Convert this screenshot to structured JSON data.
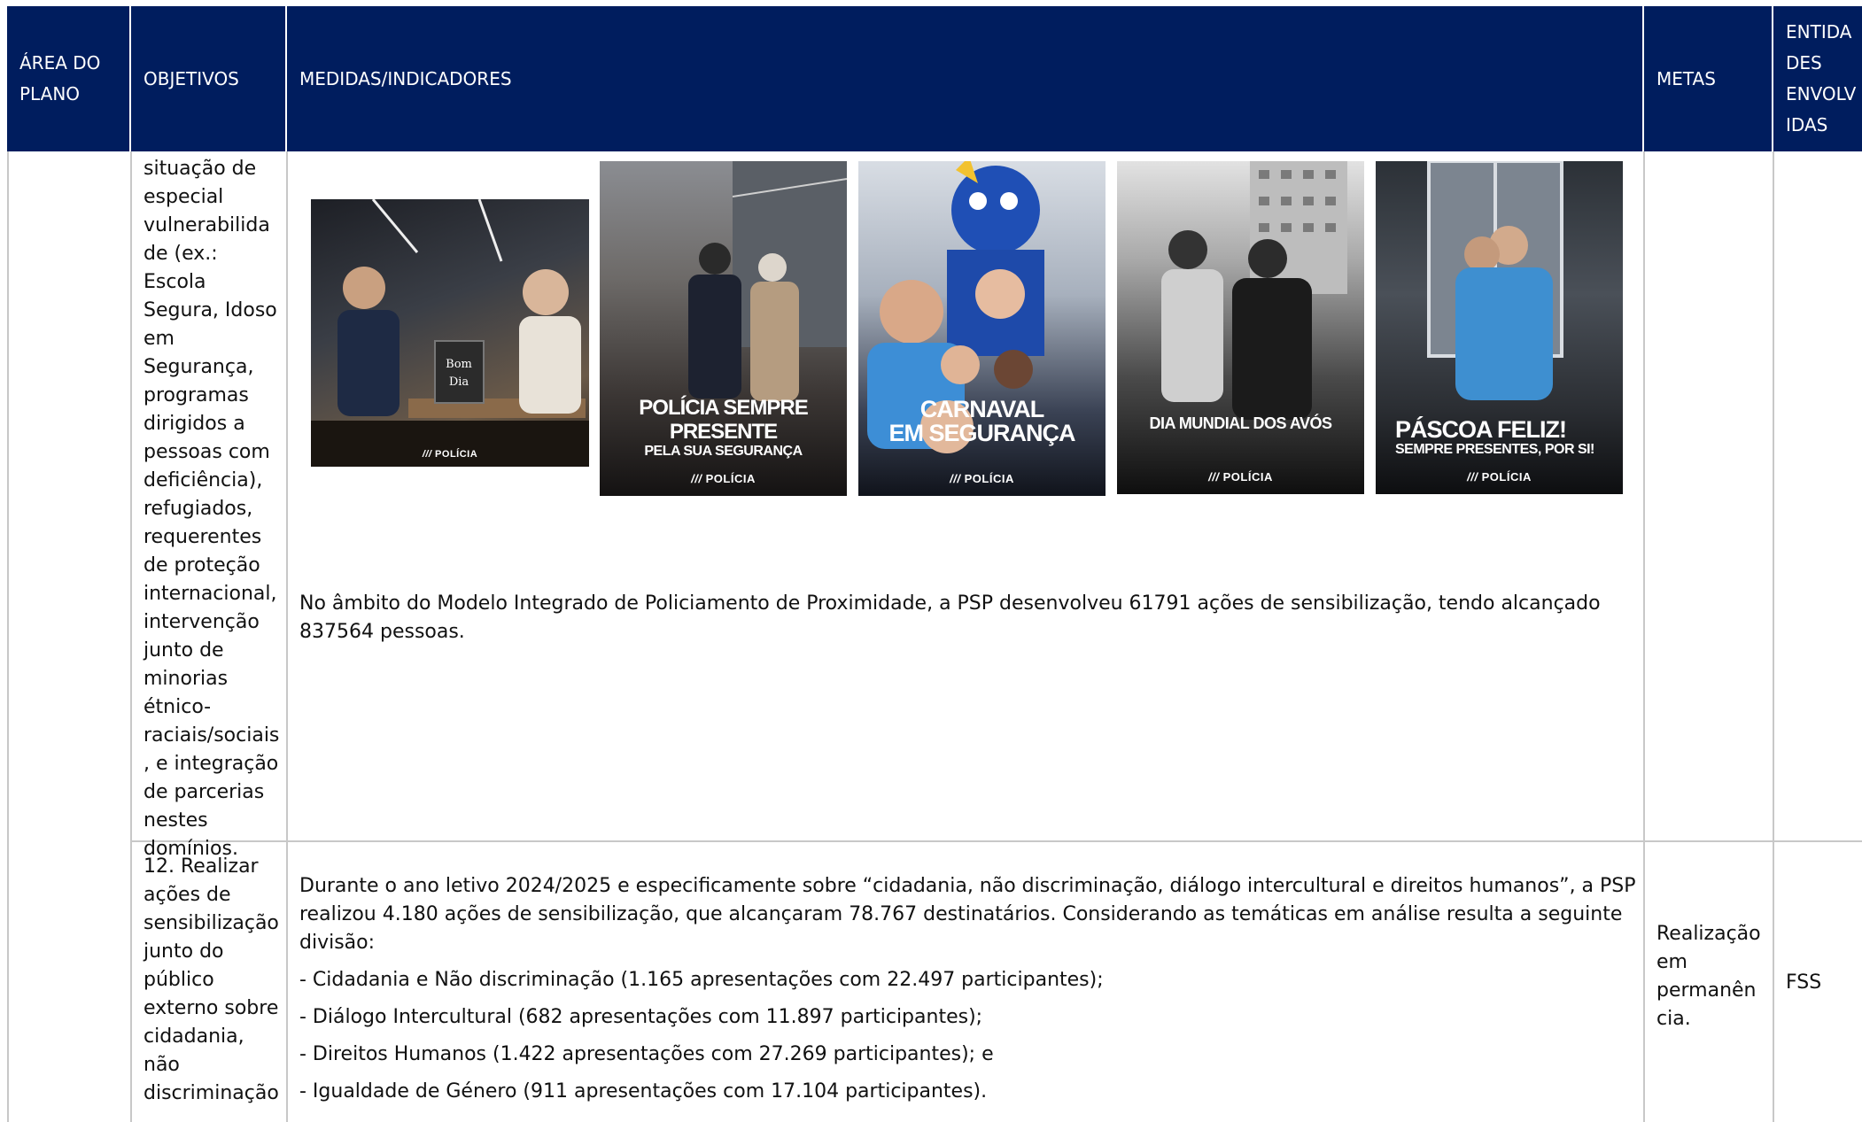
{
  "header": {
    "area": [
      "ÁREA DO",
      "PLANO"
    ],
    "objetivos": "OBJETIVOS",
    "medidas": "MEDIDAS/INDICADORES",
    "metas": "METAS",
    "entidades": [
      "ENTIDA",
      "DES",
      "ENVOLV",
      "IDAS"
    ]
  },
  "row1": {
    "objective_text": "situação de\nespecial\nvulnerabilida\nde (ex.: Escola\nSegura, Idoso\nem\nSegurança,\nprogramas\ndirigidos a\npessoas com\ndeficiência),\nrefugiados,\nrequerentes\nde proteção\ninternacional,\nintervenção\njunto de\nminorias\nétnico-\nraciais/sociais\n, e integração\nde parcerias\nnestes\ndomínios.",
    "photos": [
      {
        "caption1": "",
        "caption2": "",
        "brand": "POLÍCIA",
        "sign": "Bom Dia"
      },
      {
        "caption1": "POLÍCIA SEMPRE PRESENTE",
        "caption2": "PELA SUA SEGURANÇA",
        "brand": "POLÍCIA"
      },
      {
        "caption1": "CARNAVAL",
        "caption1b": "EM SEGURANÇA",
        "brand": "POLÍCIA"
      },
      {
        "caption1": "DIA MUNDIAL DOS AVÓS",
        "brand": "POLÍCIA"
      },
      {
        "caption1": "PÁSCOA FELIZ!",
        "caption2": "SEMPRE PRESENTES, POR SI!",
        "brand": "POLÍCIA"
      }
    ],
    "summary": "No âmbito do Modelo Integrado de Policiamento de Proximidade, a PSP desenvolveu 61791 ações de sensibilização, tendo alcançado 837564 pessoas."
  },
  "row2": {
    "objective_text": "12. Realizar\nações de\nsensibilização\njunto do\npúblico\nexterno sobre\ncidadania,\nnão\ndiscriminação",
    "intro": "Durante o ano letivo 2024/2025 e especificamente sobre “cidadania, não discriminação, diálogo intercultural e direitos humanos”, a PSP realizou 4.180 ações de sensibilização, que alcançaram 78.767 destinatários. Considerando as temáticas em análise resulta a seguinte divisão:",
    "bullets": [
      "- Cidadania e Não discriminação (1.165 apresentações com 22.497 participantes);",
      "- Diálogo Intercultural (682 apresentações com 11.897 participantes);",
      "- Direitos Humanos (1.422 apresentações com 27.269 participantes); e",
      "- Igualdade de Género (911 apresentações com 17.104 participantes)."
    ],
    "metas": "Realização\nem\npermanên\ncia.",
    "entidades": "FSS"
  },
  "colors": {
    "header_bg": "#001d5e",
    "header_text": "#ffffff",
    "border": "#c8c8c8"
  }
}
